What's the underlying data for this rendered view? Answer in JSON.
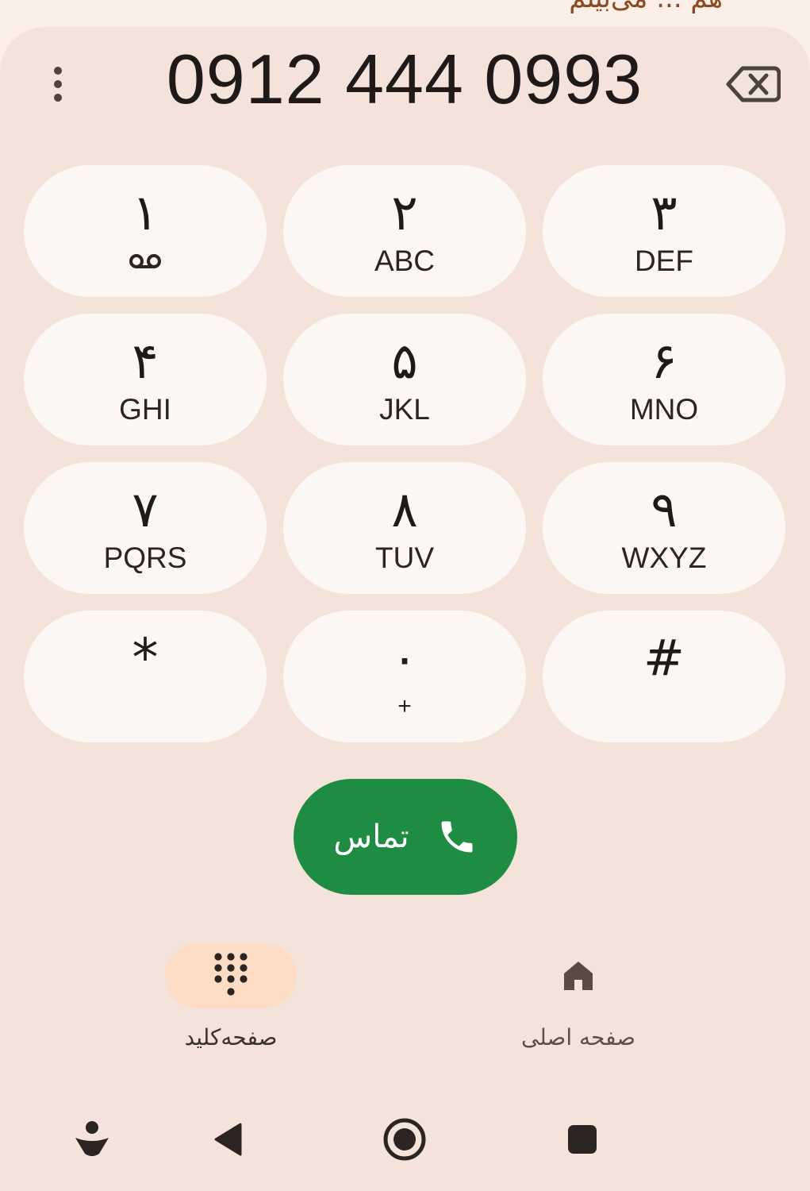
{
  "top_partial_text": "هم ... می‌بینم",
  "dialer": {
    "number": "0912 444 0993",
    "keys": [
      {
        "digit": "۱",
        "letters": "",
        "icon": "voicemail-icon"
      },
      {
        "digit": "۲",
        "letters": "ABC"
      },
      {
        "digit": "۳",
        "letters": "DEF"
      },
      {
        "digit": "۴",
        "letters": "GHI"
      },
      {
        "digit": "۵",
        "letters": "JKL"
      },
      {
        "digit": "۶",
        "letters": "MNO"
      },
      {
        "digit": "۷",
        "letters": "PQRS"
      },
      {
        "digit": "۸",
        "letters": "TUV"
      },
      {
        "digit": "۹",
        "letters": "WXYZ"
      },
      {
        "digit": "*",
        "letters": ""
      },
      {
        "digit": "۰",
        "letters": "+"
      },
      {
        "digit": "#",
        "letters": ""
      }
    ],
    "call_label": "تماس"
  },
  "bottom_nav": {
    "items": [
      {
        "label": "صفحه‌کلید",
        "icon": "dialpad-icon",
        "active": true
      },
      {
        "label": "صفحه اصلی",
        "icon": "home-icon",
        "active": false
      }
    ]
  },
  "system_nav": [
    "accessibility-icon",
    "back-icon",
    "home-circle-icon",
    "recents-icon"
  ],
  "colors": {
    "background": "#f4e3da",
    "key_background": "#fdf7f3",
    "call_green": "#1e8c42",
    "active_nav_pill": "#fcdcc5"
  }
}
